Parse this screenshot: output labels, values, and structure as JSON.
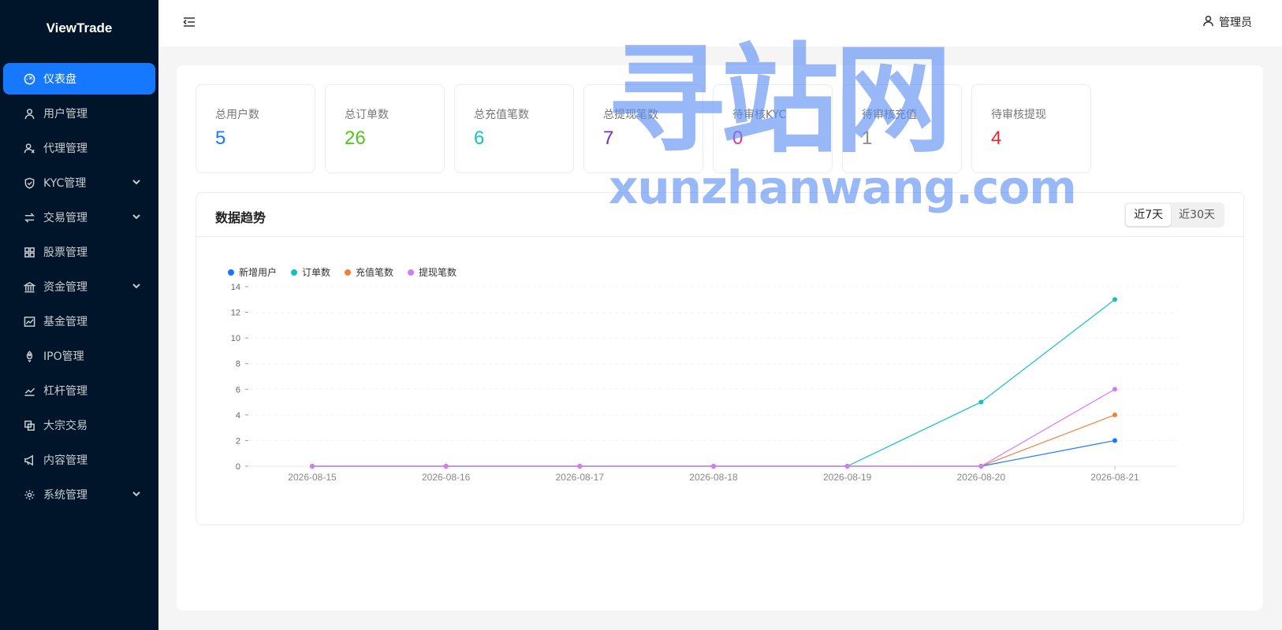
{
  "app": {
    "brand": "ViewTrade"
  },
  "sidebar": {
    "items": [
      {
        "label": "仪表盘",
        "icon": "dashboard-icon",
        "active": true,
        "has_children": false
      },
      {
        "label": "用户管理",
        "icon": "user-icon",
        "active": false,
        "has_children": false
      },
      {
        "label": "代理管理",
        "icon": "agent-icon",
        "active": false,
        "has_children": false
      },
      {
        "label": "KYC管理",
        "icon": "shield-check-icon",
        "active": false,
        "has_children": true
      },
      {
        "label": "交易管理",
        "icon": "swap-icon",
        "active": false,
        "has_children": true
      },
      {
        "label": "股票管理",
        "icon": "grid-icon",
        "active": false,
        "has_children": false
      },
      {
        "label": "资金管理",
        "icon": "bank-icon",
        "active": false,
        "has_children": true
      },
      {
        "label": "基金管理",
        "icon": "fund-chart-icon",
        "active": false,
        "has_children": false
      },
      {
        "label": "IPO管理",
        "icon": "rocket-icon",
        "active": false,
        "has_children": false
      },
      {
        "label": "杠杆管理",
        "icon": "line-chart-icon",
        "active": false,
        "has_children": false
      },
      {
        "label": "大宗交易",
        "icon": "block-icon",
        "active": false,
        "has_children": false
      },
      {
        "label": "内容管理",
        "icon": "megaphone-icon",
        "active": false,
        "has_children": false
      },
      {
        "label": "系统管理",
        "icon": "gear-icon",
        "active": false,
        "has_children": true
      }
    ]
  },
  "header": {
    "user_label": "管理员"
  },
  "stats": [
    {
      "title": "总用户数",
      "value": "5",
      "color": "#1677ff"
    },
    {
      "title": "总订单数",
      "value": "26",
      "color": "#52c41a"
    },
    {
      "title": "总充值笔数",
      "value": "6",
      "color": "#13c2c2"
    },
    {
      "title": "总提现笔数",
      "value": "7",
      "color": "#722ed1"
    },
    {
      "title": "待审核KYC",
      "value": "0",
      "color": "#eb2f96"
    },
    {
      "title": "待审核充值",
      "value": "1",
      "color": "#8c8c8c"
    },
    {
      "title": "待审核提现",
      "value": "4",
      "color": "#f5222d"
    }
  ],
  "trend": {
    "title": "数据趋势",
    "range_options": [
      "近7天",
      "近30天"
    ],
    "selected_range": "近7天"
  },
  "watermark": {
    "cn": "寻站网",
    "en": "xunzhanwang.com"
  },
  "chart_data": {
    "type": "line",
    "categories": [
      "2026-08-15",
      "2026-08-16",
      "2026-08-17",
      "2026-08-18",
      "2026-08-19",
      "2026-08-20",
      "2026-08-21"
    ],
    "series": [
      {
        "name": "新增用户",
        "color": "#1677ff",
        "values": [
          0,
          0,
          0,
          0,
          0,
          0,
          2
        ]
      },
      {
        "name": "订单数",
        "color": "#13c2c2",
        "values": [
          0,
          0,
          0,
          0,
          0,
          5,
          13
        ]
      },
      {
        "name": "充值笔数",
        "color": "#f08040",
        "values": [
          0,
          0,
          0,
          0,
          0,
          0,
          4
        ]
      },
      {
        "name": "提现笔数",
        "color": "#d27cf5",
        "values": [
          0,
          0,
          0,
          0,
          0,
          0,
          6
        ]
      }
    ],
    "ylim": [
      0,
      14
    ],
    "yticks": [
      0,
      2,
      4,
      6,
      8,
      10,
      12,
      14
    ],
    "grid": true,
    "legend": "top-left"
  }
}
